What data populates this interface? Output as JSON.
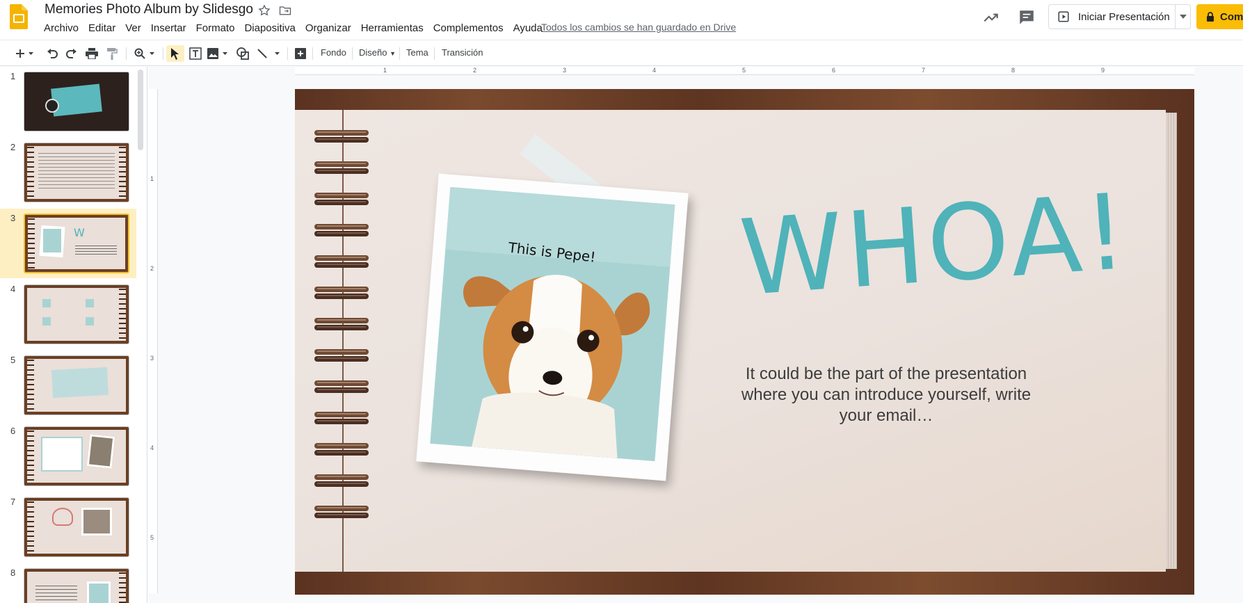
{
  "header": {
    "title": "Memories Photo Album by Slidesgo",
    "save_status": "Todos los cambios se han guardado en Drive",
    "present_label": "Iniciar Presentación",
    "share_label": "Comp"
  },
  "menu": [
    {
      "label": "Archivo"
    },
    {
      "label": "Editar"
    },
    {
      "label": "Ver"
    },
    {
      "label": "Insertar"
    },
    {
      "label": "Formato"
    },
    {
      "label": "Diapositiva"
    },
    {
      "label": "Organizar"
    },
    {
      "label": "Herramientas"
    },
    {
      "label": "Complementos"
    },
    {
      "label": "Ayuda"
    }
  ],
  "toolbar": {
    "fondo": "Fondo",
    "diseno": "Diseño",
    "tema": "Tema",
    "transicion": "Transición"
  },
  "slides": [
    {
      "number": "1"
    },
    {
      "number": "2"
    },
    {
      "number": "3"
    },
    {
      "number": "4"
    },
    {
      "number": "5"
    },
    {
      "number": "6"
    },
    {
      "number": "7"
    },
    {
      "number": "8"
    }
  ],
  "selected_slide": "3",
  "ruler": {
    "horizontal": [
      "1",
      "2",
      "3",
      "4",
      "5",
      "6",
      "7",
      "8",
      "9"
    ],
    "vertical": [
      "1",
      "2",
      "3",
      "4",
      "5"
    ]
  },
  "slide_content": {
    "photo_caption": "This is Pepe!",
    "headline": "WHOA!",
    "intro_text": "It could be the part of the presentation where you can introduce yourself, write your email…"
  },
  "colors": {
    "accent_teal": "#4fb3b9",
    "selection_yellow": "#feefc3",
    "share_button": "#fbbc04",
    "slides_logo": "#f4b400"
  }
}
